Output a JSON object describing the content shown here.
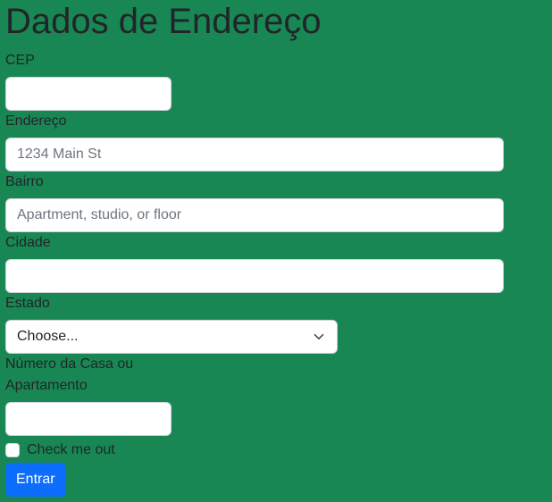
{
  "page": {
    "title": "Dados de Endereço"
  },
  "form": {
    "cep": {
      "label": "CEP",
      "value": "",
      "placeholder": ""
    },
    "endereco": {
      "label": "Endereço",
      "value": "",
      "placeholder": "1234 Main St"
    },
    "bairro": {
      "label": "Bairro",
      "value": "",
      "placeholder": "Apartment, studio, or floor"
    },
    "cidade": {
      "label": "Cidade",
      "value": "",
      "placeholder": ""
    },
    "estado": {
      "label": "Estado",
      "selected": "Choose..."
    },
    "numero": {
      "label": "Número da Casa ou Apartamento",
      "value": "",
      "placeholder": ""
    },
    "check": {
      "label": "Check me out",
      "checked": false
    },
    "submit_label": "Entrar"
  },
  "colors": {
    "background": "#198754",
    "button": "#0d6efd"
  },
  "icons": {
    "select_arrow": "chevron-down-icon"
  }
}
